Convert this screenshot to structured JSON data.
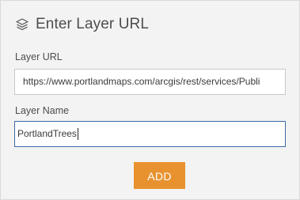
{
  "header": {
    "icon": "layers-icon",
    "title": "Enter Layer URL"
  },
  "form": {
    "layer_url": {
      "label": "Layer URL",
      "value": "https://www.portlandmaps.com/arcgis/rest/services/Publi"
    },
    "layer_name": {
      "label": "Layer Name",
      "value": "PortlandTrees"
    },
    "add_button_label": "ADD"
  },
  "colors": {
    "panel_background": "#f3f3f3",
    "accent_button": "#e8922f",
    "focused_border": "#3c6aa8"
  }
}
